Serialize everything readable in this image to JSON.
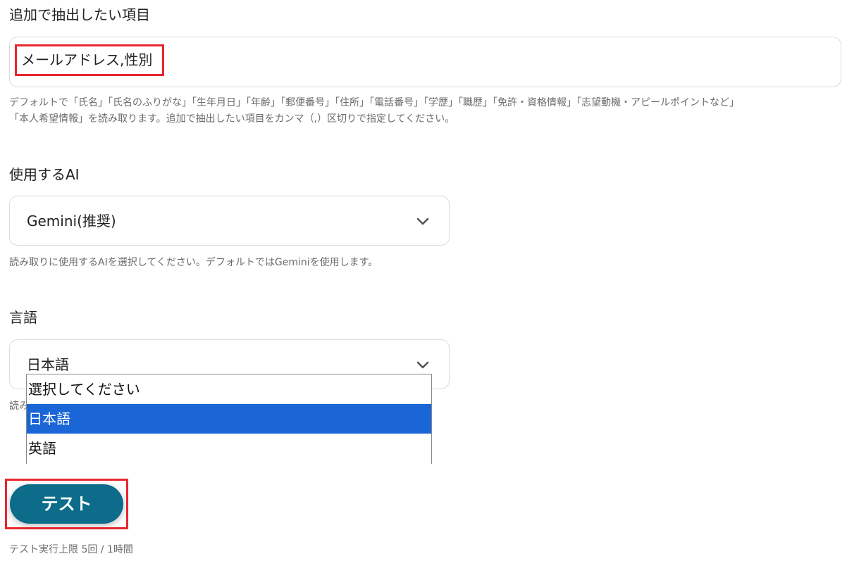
{
  "extract_fields": {
    "label": "追加で抽出したい項目",
    "value": "メールアドレス,性別",
    "help_line1": "デフォルトで「氏名」「氏名のふりがな」「生年月日」「年齢」「郵便番号」「住所」「電話番号」「学歴」「職歴」「免許・資格情報」「志望動機・アピールポイントなど」",
    "help_line2": "「本人希望情報」を読み取ります。追加で抽出したい項目をカンマ（,）区切りで指定してください。"
  },
  "ai_select": {
    "label": "使用するAI",
    "value": "Gemini(推奨)",
    "help": "読み取りに使用するAIを選択してください。デフォルトではGeminiを使用します。"
  },
  "language_select": {
    "label": "言語",
    "value": "日本語",
    "help_visible": "読み",
    "options": [
      "選択してください",
      "日本語",
      "英語"
    ],
    "selected_option": "日本語"
  },
  "test": {
    "button_label": "テスト",
    "limit_text": "テスト実行上限 5回 / 1時間"
  },
  "colors": {
    "button_bg": "#0c6c89",
    "highlight_red": "#e8262f",
    "option_selected_bg": "#1a66d6"
  }
}
